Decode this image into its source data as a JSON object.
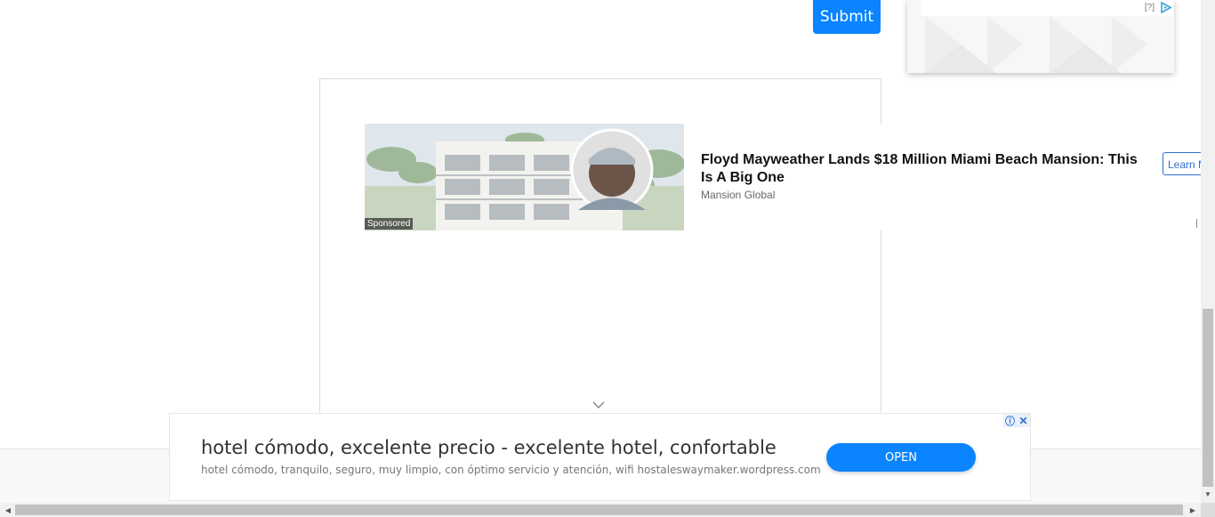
{
  "form": {
    "submit_label": "Submit"
  },
  "top_ad": {
    "help_label": "[?]"
  },
  "sponsored_card": {
    "title": "Floyd Mayweather Lands $18 Million Miami Beach Mansion: This Is A Big One",
    "source": "Mansion Global",
    "sponsored_label": "Sponsored",
    "cta_label": "Learn More"
  },
  "bottom_ad": {
    "headline": "hotel cómodo, excelente precio - excelente hotel, confortable",
    "description": "hotel cómodo, tranquilo, seguro, muy limpio, con óptimo servicio y atención, wifi hostaleswaymaker.wordpress.com",
    "open_label": "OPEN",
    "info_icon": "info-icon",
    "close_icon": "close-icon"
  },
  "colors": {
    "accent": "#0a84ff",
    "link": "#2e6fd1"
  }
}
